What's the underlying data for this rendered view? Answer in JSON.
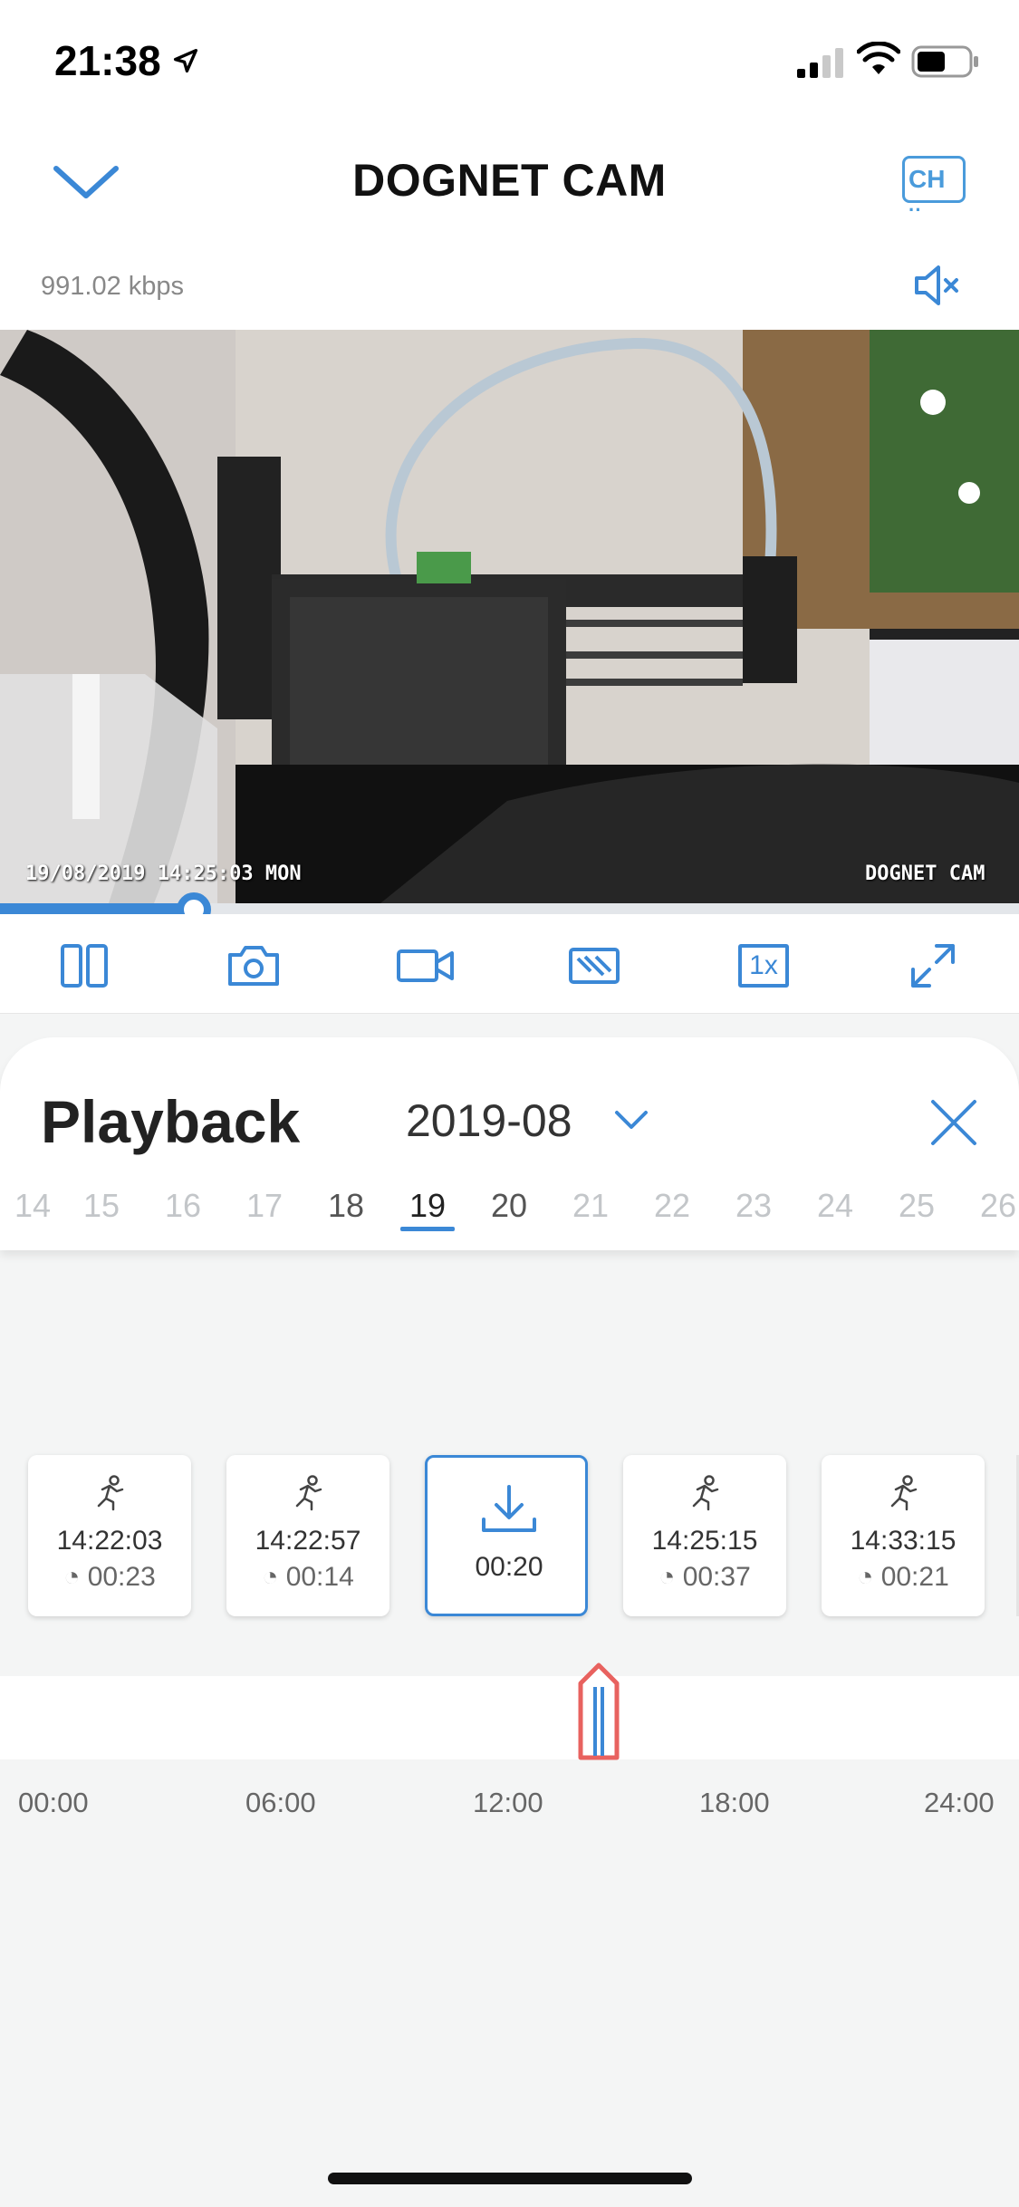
{
  "status": {
    "time": "21:38"
  },
  "header": {
    "title": "DOGNET CAM",
    "channel_label": "CH",
    "bitrate": "991.02 kbps"
  },
  "video": {
    "osd_datetime": "19/08/2019 14:25:03 MON",
    "osd_camera_name": "DOGNET CAM",
    "progress": 0.19
  },
  "toolbar": {
    "icons": [
      "split-view-icon",
      "camera-snapshot-icon",
      "video-record-icon",
      "hd-quality-icon",
      "speed-1x-icon",
      "fullscreen-icon"
    ],
    "speed_label": "1x"
  },
  "playback": {
    "title": "Playback",
    "month": "2019-08",
    "days": [
      "14",
      "15",
      "16",
      "17",
      "18",
      "19",
      "20",
      "21",
      "22",
      "23",
      "24",
      "25",
      "26"
    ],
    "selected_day": "19"
  },
  "clips": [
    {
      "type": "motion",
      "time": "14:22:03",
      "duration": "00:23"
    },
    {
      "type": "motion",
      "time": "14:22:57",
      "duration": "00:14"
    },
    {
      "type": "download",
      "time": "",
      "duration": "00:20"
    },
    {
      "type": "motion",
      "time": "14:25:15",
      "duration": "00:37"
    },
    {
      "type": "motion",
      "time": "14:33:15",
      "duration": "00:21"
    }
  ],
  "timeline": {
    "labels": [
      "00:00",
      "06:00",
      "12:00",
      "18:00",
      "24:00"
    ],
    "marker_time": "14:25"
  },
  "colors": {
    "accent": "#3b88d6",
    "marker": "#e8625f"
  }
}
